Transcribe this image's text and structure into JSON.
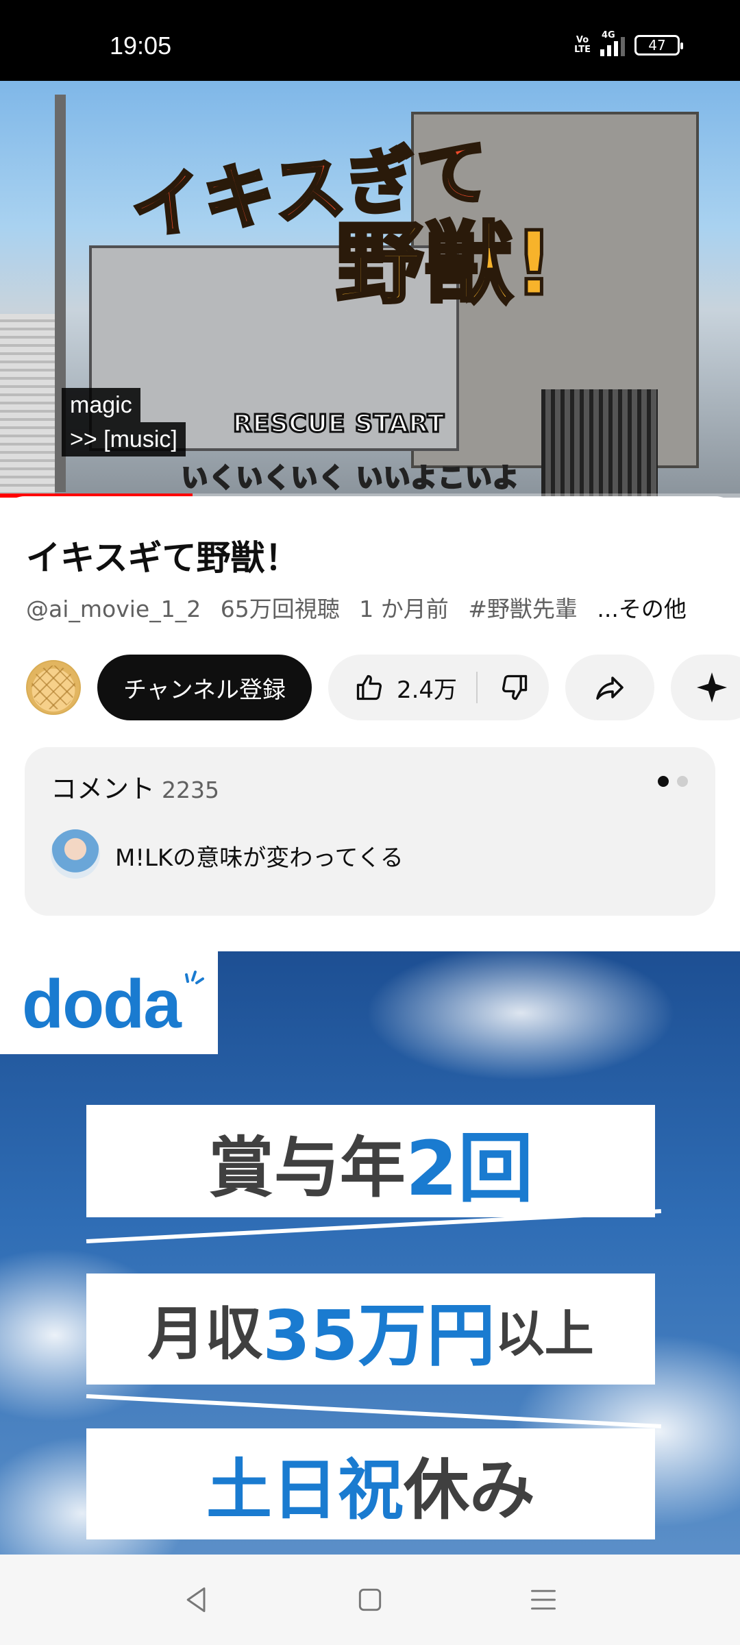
{
  "status_bar": {
    "time": "19:05",
    "volte": "Vo LTE",
    "network": "4G",
    "battery": "47"
  },
  "video": {
    "title_art_line1": "イキスぎて",
    "title_art_line2": "野獣!",
    "rescue_text": "RESCUE START",
    "lyric": "いくいくいく いいよこいよ",
    "captions": [
      "magic",
      ">> [music]"
    ],
    "progress_fraction": 0.26,
    "progress_color": "#ff0000"
  },
  "details": {
    "title": "イキスギて野獣！",
    "channel_handle": "@ai_movie_1_2",
    "views": "65万回視聴",
    "age": "1 か月前",
    "hashtag": "#野獣先輩",
    "more": "...その他"
  },
  "actions": {
    "subscribe_label": "チャンネル登録",
    "like_count": "2.4万",
    "icons": [
      "thumbs-up-icon",
      "thumbs-down-icon",
      "share-icon",
      "sparkle-icon"
    ]
  },
  "comments": {
    "title": "コメント",
    "count": "2235",
    "top_comment": "M!LKの意味が変わってくる"
  },
  "ad": {
    "brand": "doda",
    "brand_color": "#1a7bd0",
    "line1_dark": "賞与年",
    "line1_blue": "2回",
    "line2_dark_a": "月収",
    "line2_blue": "35万円",
    "line2_dark_b": "以上",
    "line3_blue": "土日祝",
    "line3_dark": "休み"
  },
  "nav": {
    "icons": [
      "back-icon",
      "home-icon",
      "recents-icon"
    ]
  }
}
